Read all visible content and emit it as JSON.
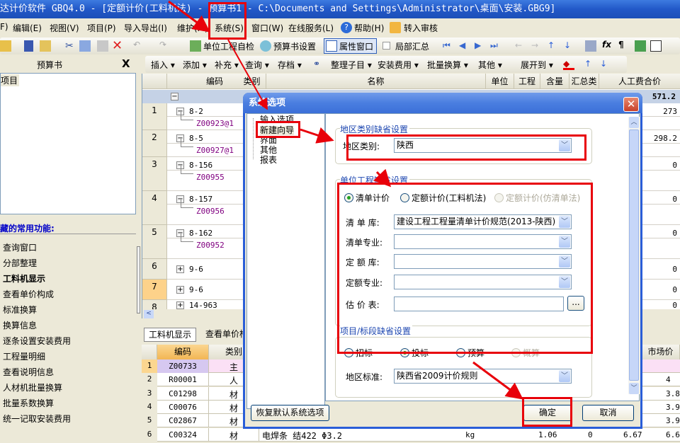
{
  "window": {
    "title": "达计价软件 GBQ4.0 - [定额计价(工料机法) - 预算书1 - C:\\Documents and Settings\\Administrator\\桌面\\安装.GBG9]"
  },
  "menu": [
    "F)",
    "编辑(E)",
    "视图(V)",
    "项目(P)",
    "导入导出(I)",
    "维护(M)",
    "系统(S)",
    "窗口(W)",
    "在线服务(L)",
    "帮助(H)",
    "转入审核"
  ],
  "toolbar1": {
    "self_check": "单位工程自检",
    "budget_settings": "预算书设置",
    "property_window": "属性窗口",
    "partial_summary": "局部汇总"
  },
  "toolbar2": [
    "插入 ▾",
    "添加 ▾",
    "补充 ▾",
    "查询 ▾",
    "存档 ▾",
    "整理子目 ▾",
    "安装费用 ▾",
    "批量换算 ▾",
    "其他 ▾",
    "展开到 ▾"
  ],
  "left_panel": {
    "title": "预算书",
    "close": "X",
    "tree_item": "项目",
    "functions_title": "藏的常用功能:",
    "functions": [
      "查询窗口",
      "分部整理",
      "工料机显示",
      "查看单价构成",
      "标准换算",
      "换算信息",
      "逐条设置安装费用",
      "工程量明细",
      "查看说明信息",
      "人材机批量换算",
      "批量系数换算",
      "统一记取安装费用"
    ]
  },
  "grid": {
    "headers": [
      "编码",
      "类别",
      "名称",
      "单位",
      "工程",
      "含量",
      "汇总类",
      "人工费合价"
    ],
    "group_total": "571.2",
    "rows": [
      {
        "num": "1",
        "code": "8-2",
        "sub": "Z00923@1",
        "labor": "273",
        "expanded": true
      },
      {
        "num": "2",
        "code": "8-5",
        "sub": "Z00927@1",
        "labor": "298.2",
        "expanded": true
      },
      {
        "num": "3",
        "code": "8-156",
        "sub": "Z00955",
        "labor": "0",
        "expanded": true
      },
      {
        "num": "4",
        "code": "8-157",
        "sub": "Z00956",
        "labor": "0",
        "expanded": true
      },
      {
        "num": "5",
        "code": "8-162",
        "sub": "Z00952",
        "labor": "0",
        "expanded": true
      },
      {
        "num": "6",
        "code": "9-6",
        "labor": "0",
        "expanded": false
      },
      {
        "num": "7",
        "code": "9-6",
        "labor": "0",
        "expanded": false,
        "selected": true
      },
      {
        "num": "8",
        "code": "14-963",
        "labor": "0",
        "expanded": false
      }
    ]
  },
  "bottom": {
    "tabs": [
      "工料机显示",
      "查看单价构成"
    ],
    "headers": [
      "编码",
      "类别",
      "市场价"
    ],
    "rows": [
      {
        "num": "1",
        "code": "Z00733",
        "type": "主",
        "name": "",
        "unit": "",
        "qty": "",
        "v1": "",
        "v2": "",
        "price": ""
      },
      {
        "num": "2",
        "code": "R00001",
        "type": "人",
        "name": "",
        "unit": "",
        "qty": "",
        "v1": "",
        "v2": "",
        "price": "4"
      },
      {
        "num": "3",
        "code": "C01298",
        "type": "材",
        "name": "",
        "unit": "",
        "qty": "",
        "v1": "",
        "v2": "",
        "price": "3.8"
      },
      {
        "num": "4",
        "code": "C00076",
        "type": "材",
        "name": "",
        "unit": "",
        "qty": "",
        "v1": "",
        "v2": "",
        "price": "3.9"
      },
      {
        "num": "5",
        "code": "C02867",
        "type": "材",
        "name": "",
        "unit": "",
        "qty": "",
        "v1": "",
        "v2": "",
        "price": "3.9"
      },
      {
        "num": "6",
        "code": "C00324",
        "type": "材",
        "name": "电焊条 结422 Φ3.2",
        "unit": "kg",
        "qty": "1.06",
        "v1": "0",
        "v2": "6.67",
        "price": "6.6"
      }
    ]
  },
  "dialog": {
    "title": "系统选项",
    "close": "✕",
    "tree": [
      "输入选项",
      "新建向导",
      "界面",
      "其他",
      "报表"
    ],
    "region_group": {
      "title": "地区类别缺省设置",
      "label": "地区类别:",
      "value": "陕西"
    },
    "unit_group": {
      "title": "单位工程缺省设置",
      "radios": [
        {
          "label": "清单计价",
          "checked": true,
          "disabled": false
        },
        {
          "label": "定额计价(工料机法)",
          "checked": false,
          "disabled": false
        },
        {
          "label": "定额计价(仿清单法)",
          "checked": false,
          "disabled": true
        }
      ],
      "fields": [
        {
          "label": "清 单 库:",
          "value": "建设工程工程量清单计价规范(2013-陕西)"
        },
        {
          "label": "清单专业:",
          "value": ""
        },
        {
          "label": "定 额 库:",
          "value": ""
        },
        {
          "label": "定额专业:",
          "value": ""
        }
      ],
      "price_table_label": "估 价 表:",
      "price_table_value": "",
      "browse": "..."
    },
    "project_group": {
      "title": "项目/标段缺省设置",
      "radios": [
        {
          "label": "招标",
          "checked": false,
          "disabled": false
        },
        {
          "label": "投标",
          "checked": true,
          "disabled": false
        },
        {
          "label": "预算",
          "checked": false,
          "disabled": false
        },
        {
          "label": "概算",
          "checked": false,
          "disabled": true
        }
      ],
      "standard_label": "地区标准:",
      "standard_value": "陕西省2009计价规则"
    },
    "restore": "恢复默认系统选项",
    "ok": "确定",
    "cancel": "取消"
  },
  "annotation_color": "#e8000a"
}
